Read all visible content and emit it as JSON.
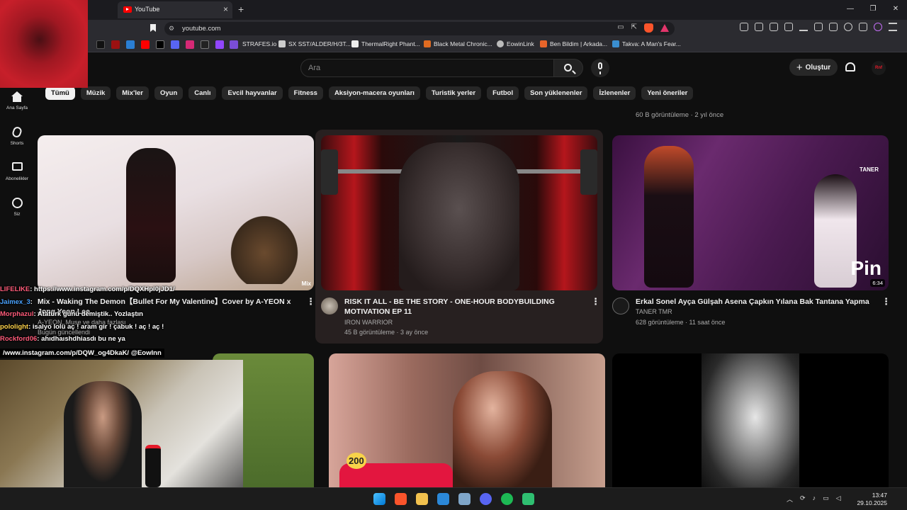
{
  "browser": {
    "tab_title": "YouTube",
    "url": "youtube.com",
    "window_controls": [
      "—",
      "❐",
      "✕"
    ],
    "bookmarks": [
      "STRAFES.io",
      "SX SST/ALDER/H/3T...",
      "ThermalRight Phant...",
      "Black Metal Chronic...",
      "EowinLink",
      "Ben Bildim | Arkada...",
      "Takva: A Man's Fear..."
    ]
  },
  "youtube": {
    "search_placeholder": "Ara",
    "create_label": "Oluştur",
    "avatar_text": "Rnf",
    "sidebar": [
      {
        "label": "Ana Sayfa",
        "icon": "home-icon"
      },
      {
        "label": "Shorts",
        "icon": "shorts-icon"
      },
      {
        "label": "Abonelikler",
        "icon": "subscriptions-icon"
      },
      {
        "label": "Siz",
        "icon": "you-icon"
      }
    ],
    "chips": [
      "Tümü",
      "Müzik",
      "Mix'ler",
      "Oyun",
      "Canlı",
      "Evcil hayvanlar",
      "Fitness",
      "Aksiyon-macera oyunları",
      "Turistik yerler",
      "Futbol",
      "Son yüklenenler",
      "İzlenenler",
      "Yeni öneriler"
    ],
    "prev_row_meta": "60 B görüntüleme · 2 yıl önce",
    "videos": [
      {
        "title": "Mix - Waking The Demon【Bullet For My Valentine】Cover by A-YEON x Jong Yeon Lee",
        "channel": "A-YEON, Muse ve daha fazlası",
        "meta": "Bugün güncellendi",
        "badge": "Mix"
      },
      {
        "title": "RISK IT ALL - BE THE STORY - ONE-HOUR BODYBUILDING MOTIVATION EP 11",
        "channel": "IRON WARRIOR",
        "meta": "45 B görüntüleme · 3 ay önce"
      },
      {
        "title": "Erkal Sonel Ayça Gülşah Asena Çapkın Yılana Bak Tantana Yapma",
        "channel": "TANER TMR",
        "meta": "628 görüntüleme · 11 saat önce",
        "duration": "6:34",
        "watermark": "Pin",
        "logo_text": "TANER"
      },
      {
        "badge_number": "200"
      }
    ]
  },
  "stream_overlay": {
    "chat": [
      {
        "user": "LIFELIKE",
        "message": ": https://www.instagram.com/p/DQXHpl0jJD1/"
      },
      {
        "user": "Jaimex_3",
        "message": ":"
      },
      {
        "user": "Morphazul",
        "message": ": Atatürk günü demiştik.. Yozlaştın"
      },
      {
        "user": "pololight",
        "message": ": isalyo lolü aç ! aram gir ! çabuk ! aç ! aç !"
      },
      {
        "user": "Rockford06",
        "message": ": ahıdhaıshdhiasdı bu ne ya"
      }
    ],
    "promo": "/www.instagram.com/p/DQW_og4DkaK/ @EowInn"
  },
  "taskbar": {
    "time": "13:47",
    "date": "29.10.2025"
  },
  "colors": {
    "youtube_red": "#ff0000",
    "webcam_border": "#19ff3f",
    "chat_username": "#ff5c7a"
  }
}
